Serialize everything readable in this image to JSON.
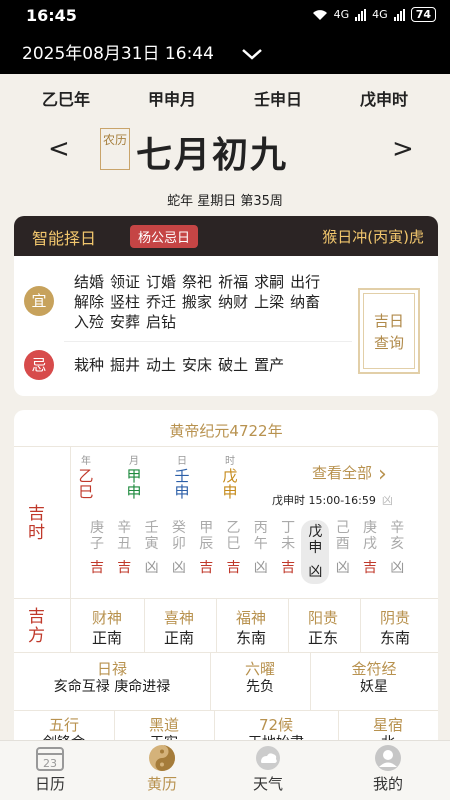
{
  "status": {
    "time": "16:45",
    "net1": "4G",
    "net2": "4G",
    "battery": "74"
  },
  "header": {
    "datetime": "2025年08月31日 16:44"
  },
  "ganzhi": {
    "year": "乙巳年",
    "month": "甲申月",
    "day": "壬申日",
    "hour": "戊申时"
  },
  "lunar": {
    "badge": "农历",
    "date": "七月初九",
    "prev": "<",
    "next": ">"
  },
  "subdate": {
    "zodiac": "蛇年",
    "weekday": "星期日",
    "week": "第35周"
  },
  "yiji": {
    "title": "智能择日",
    "tag": "杨公忌日",
    "clash": "猴日冲(丙寅)虎",
    "yi_label": "宜",
    "ji_label": "忌",
    "yi": [
      "结婚",
      "领证",
      "订婚",
      "祭祀",
      "祈福",
      "求嗣",
      "出行",
      "解除",
      "竖柱",
      "乔迁",
      "搬家",
      "纳财",
      "上梁",
      "纳畜",
      "入殓",
      "安葬",
      "启钻"
    ],
    "ji": [
      "栽种",
      "掘井",
      "动土",
      "安床",
      "破土",
      "置产"
    ],
    "stamp": "吉日查询"
  },
  "almanac": {
    "era": "黄帝纪元4722年",
    "jishi_label": "吉时",
    "pillars": [
      {
        "lab": "年",
        "gan": "乙",
        "zhi": "巳"
      },
      {
        "lab": "月",
        "gan": "甲",
        "zhi": "申"
      },
      {
        "lab": "日",
        "gan": "壬",
        "zhi": "申"
      },
      {
        "lab": "时",
        "gan": "戊",
        "zhi": "申"
      }
    ],
    "view_all": "查看全部",
    "current_hour": "戊申时 15:00-16:59",
    "current_hour_status": "凶",
    "hours": [
      {
        "gan": "庚",
        "zhi": "子",
        "st": "吉"
      },
      {
        "gan": "辛",
        "zhi": "丑",
        "st": "吉"
      },
      {
        "gan": "壬",
        "zhi": "寅",
        "st": "凶"
      },
      {
        "gan": "癸",
        "zhi": "卯",
        "st": "凶"
      },
      {
        "gan": "甲",
        "zhi": "辰",
        "st": "吉"
      },
      {
        "gan": "乙",
        "zhi": "巳",
        "st": "吉"
      },
      {
        "gan": "丙",
        "zhi": "午",
        "st": "凶"
      },
      {
        "gan": "丁",
        "zhi": "未",
        "st": "吉"
      },
      {
        "gan": "戊",
        "zhi": "申",
        "st": "凶"
      },
      {
        "gan": "己",
        "zhi": "酉",
        "st": "凶"
      },
      {
        "gan": "庚",
        "zhi": "戌",
        "st": "吉"
      },
      {
        "gan": "辛",
        "zhi": "亥",
        "st": "凶"
      }
    ],
    "jifang_label": "吉方",
    "directions": [
      {
        "k": "财神",
        "v": "正南"
      },
      {
        "k": "喜神",
        "v": "正南"
      },
      {
        "k": "福神",
        "v": "东南"
      },
      {
        "k": "阳贵",
        "v": "正东"
      },
      {
        "k": "阴贵",
        "v": "东南"
      }
    ],
    "rilu_k": "日禄",
    "rilu_v": "亥命互禄 庚命进禄",
    "liuyao_k": "六曜",
    "liuyao_v": "先负",
    "jinfu_k": "金符经",
    "jinfu_v": "妖星",
    "wuxing_k": "五行",
    "wuxing_v": "剑锋金",
    "heidao_k": "黑道",
    "heidao_v": "天牢",
    "hou_k": "72候",
    "hou_v": "天地始肃",
    "xiu_k": "星宿",
    "xiu_v": "北"
  },
  "tabs": [
    {
      "label": "日历",
      "icon": "calendar-icon"
    },
    {
      "label": "黄历",
      "icon": "yinyang-icon"
    },
    {
      "label": "天气",
      "icon": "weather-icon"
    },
    {
      "label": "我的",
      "icon": "profile-icon"
    }
  ],
  "calendar_icon_day": "23",
  "colors": {
    "gold": "#b8924f",
    "red": "#c0392b",
    "dark": "#2b2424"
  }
}
